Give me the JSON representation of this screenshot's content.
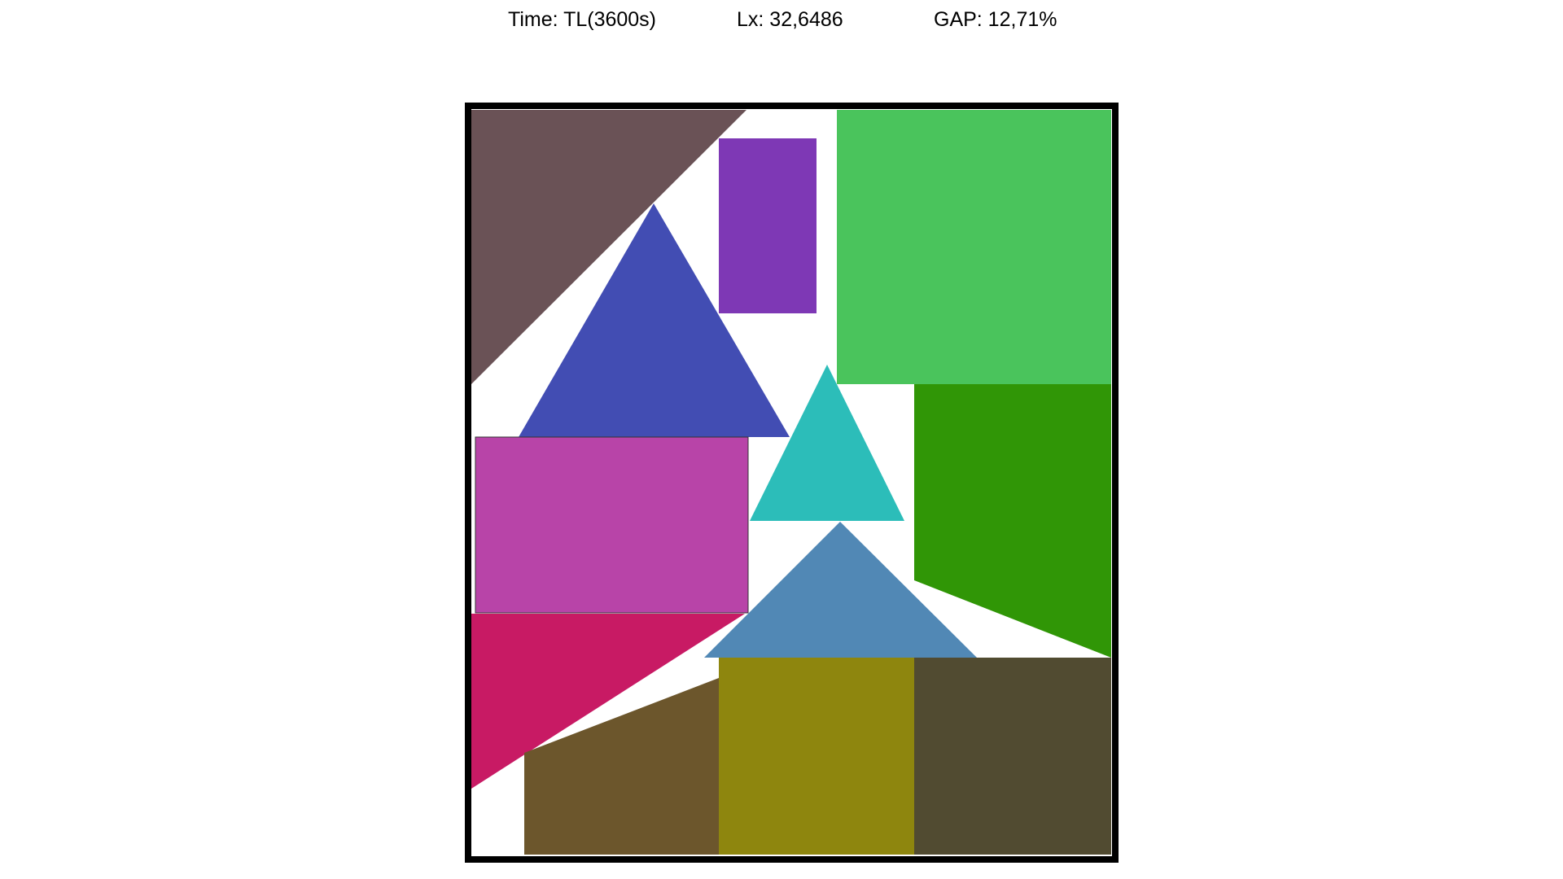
{
  "header": {
    "time_label": "Time: TL(3600s)",
    "lx_label": "Lx: 32,6486",
    "gap_label": "GAP: 12,71%"
  },
  "pieces": [
    {
      "name": "brown-triangle",
      "color": "#6a5256",
      "shape": "right-triangle"
    },
    {
      "name": "purple-rectangle",
      "color": "#7e38b5",
      "shape": "rectangle"
    },
    {
      "name": "green-square",
      "color": "#4ac45c",
      "shape": "square"
    },
    {
      "name": "blue-triangle",
      "color": "#424db3",
      "shape": "triangle"
    },
    {
      "name": "cyan-triangle",
      "color": "#2cbdb9",
      "shape": "triangle"
    },
    {
      "name": "dark-green-trapezoid",
      "color": "#309606",
      "shape": "trapezoid"
    },
    {
      "name": "magenta-rectangle",
      "color": "#b844a8",
      "shape": "rectangle"
    },
    {
      "name": "crimson-triangle",
      "color": "#c81a64",
      "shape": "triangle"
    },
    {
      "name": "steel-blue-triangle",
      "color": "#5188b5",
      "shape": "triangle"
    },
    {
      "name": "brown-trapezoid",
      "color": "#6c562c",
      "shape": "trapezoid"
    },
    {
      "name": "olive-rectangle",
      "color": "#8e860e",
      "shape": "rectangle"
    },
    {
      "name": "dark-olive-rectangle",
      "color": "#514b31",
      "shape": "rectangle"
    }
  ],
  "container": {
    "color": "#000000",
    "fill": "#ffffff"
  }
}
